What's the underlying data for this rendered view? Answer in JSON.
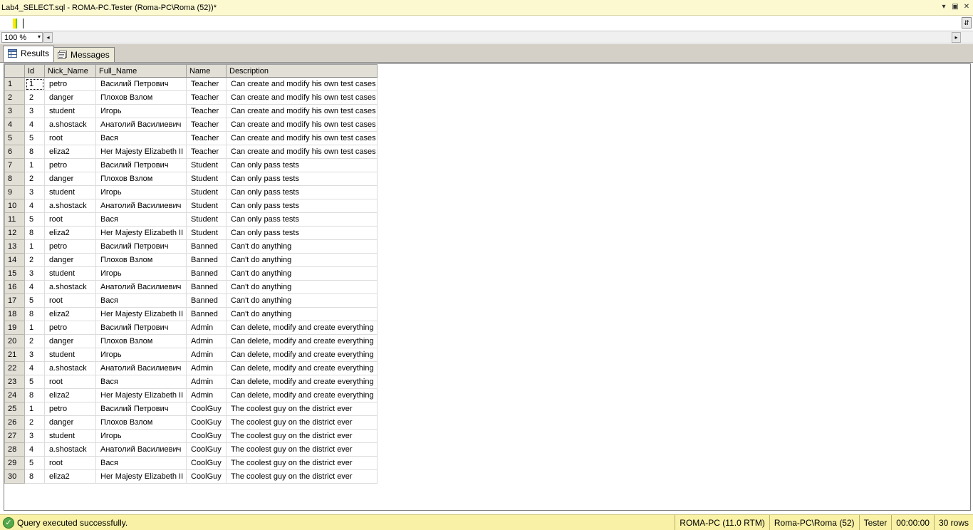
{
  "window": {
    "title": "Lab4_SELECT.sql - ROMA-PC.Tester (Roma-PC\\Roma (52))*",
    "controls": [
      "▾",
      "▣",
      "✕"
    ]
  },
  "editor": {
    "split_icon": "splitter-icon"
  },
  "zoom": {
    "value": "100 %",
    "options_arrow": "▾",
    "scroll_left": "◂",
    "scroll_right": "▸"
  },
  "tabs": [
    {
      "label": "Results",
      "icon": "grid-icon",
      "active": true
    },
    {
      "label": "Messages",
      "icon": "messages-icon",
      "active": false
    }
  ],
  "grid": {
    "columns": [
      "Id",
      "Nick_Name",
      "Full_Name",
      "Name",
      "Description"
    ],
    "rows": [
      [
        "1",
        "1",
        "petro",
        "Василий Петрович",
        "Teacher",
        "Can create and modify his own test cases"
      ],
      [
        "2",
        "2",
        "danger",
        "Плохов Взлом",
        "Teacher",
        "Can create and modify his own test cases"
      ],
      [
        "3",
        "3",
        "student",
        "Игорь",
        "Teacher",
        "Can create and modify his own test cases"
      ],
      [
        "4",
        "4",
        "a.shostack",
        "Анатолий Василиевич",
        "Teacher",
        "Can create and modify his own test cases"
      ],
      [
        "5",
        "5",
        "root",
        "Вася",
        "Teacher",
        "Can create and modify his own test cases"
      ],
      [
        "6",
        "8",
        "eliza2",
        "Her Majesty Elizabeth II",
        "Teacher",
        "Can create and modify his own test cases"
      ],
      [
        "7",
        "1",
        "petro",
        "Василий Петрович",
        "Student",
        "Can only pass tests"
      ],
      [
        "8",
        "2",
        "danger",
        "Плохов Взлом",
        "Student",
        "Can only pass tests"
      ],
      [
        "9",
        "3",
        "student",
        "Игорь",
        "Student",
        "Can only pass tests"
      ],
      [
        "10",
        "4",
        "a.shostack",
        "Анатолий Василиевич",
        "Student",
        "Can only pass tests"
      ],
      [
        "11",
        "5",
        "root",
        "Вася",
        "Student",
        "Can only pass tests"
      ],
      [
        "12",
        "8",
        "eliza2",
        "Her Majesty Elizabeth II",
        "Student",
        "Can only pass tests"
      ],
      [
        "13",
        "1",
        "petro",
        "Василий Петрович",
        "Banned",
        "Can't do anything"
      ],
      [
        "14",
        "2",
        "danger",
        "Плохов Взлом",
        "Banned",
        "Can't do anything"
      ],
      [
        "15",
        "3",
        "student",
        "Игорь",
        "Banned",
        "Can't do anything"
      ],
      [
        "16",
        "4",
        "a.shostack",
        "Анатолий Василиевич",
        "Banned",
        "Can't do anything"
      ],
      [
        "17",
        "5",
        "root",
        "Вася",
        "Banned",
        "Can't do anything"
      ],
      [
        "18",
        "8",
        "eliza2",
        "Her Majesty Elizabeth II",
        "Banned",
        "Can't do anything"
      ],
      [
        "19",
        "1",
        "petro",
        "Василий Петрович",
        "Admin",
        "Can delete, modify and create everything"
      ],
      [
        "20",
        "2",
        "danger",
        "Плохов Взлом",
        "Admin",
        "Can delete, modify and create everything"
      ],
      [
        "21",
        "3",
        "student",
        "Игорь",
        "Admin",
        "Can delete, modify and create everything"
      ],
      [
        "22",
        "4",
        "a.shostack",
        "Анатолий Василиевич",
        "Admin",
        "Can delete, modify and create everything"
      ],
      [
        "23",
        "5",
        "root",
        "Вася",
        "Admin",
        "Can delete, modify and create everything"
      ],
      [
        "24",
        "8",
        "eliza2",
        "Her Majesty Elizabeth II",
        "Admin",
        "Can delete, modify and create everything"
      ],
      [
        "25",
        "1",
        "petro",
        "Василий Петрович",
        "CoolGuy",
        "The coolest guy on the district ever"
      ],
      [
        "26",
        "2",
        "danger",
        "Плохов Взлом",
        "CoolGuy",
        "The coolest guy on the district ever"
      ],
      [
        "27",
        "3",
        "student",
        "Игорь",
        "CoolGuy",
        "The coolest guy on the district ever"
      ],
      [
        "28",
        "4",
        "a.shostack",
        "Анатолий Василиевич",
        "CoolGuy",
        "The coolest guy on the district ever"
      ],
      [
        "29",
        "5",
        "root",
        "Вася",
        "CoolGuy",
        "The coolest guy on the district ever"
      ],
      [
        "30",
        "8",
        "eliza2",
        "Her Majesty Elizabeth II",
        "CoolGuy",
        "The coolest guy on the district ever"
      ]
    ]
  },
  "status": {
    "icon": "check-circle-icon",
    "icon_glyph": "✓",
    "message": "Query executed successfully.",
    "server": "ROMA-PC (11.0 RTM)",
    "login": "Roma-PC\\Roma (52)",
    "database": "Tester",
    "elapsed": "00:00:00",
    "rowcount": "30 rows"
  },
  "colors": {
    "title_bg": "#fcf8cf",
    "status_bg": "#f8f1a6",
    "header_bg": "#e2dfd6",
    "ok_green": "#55a84a"
  }
}
